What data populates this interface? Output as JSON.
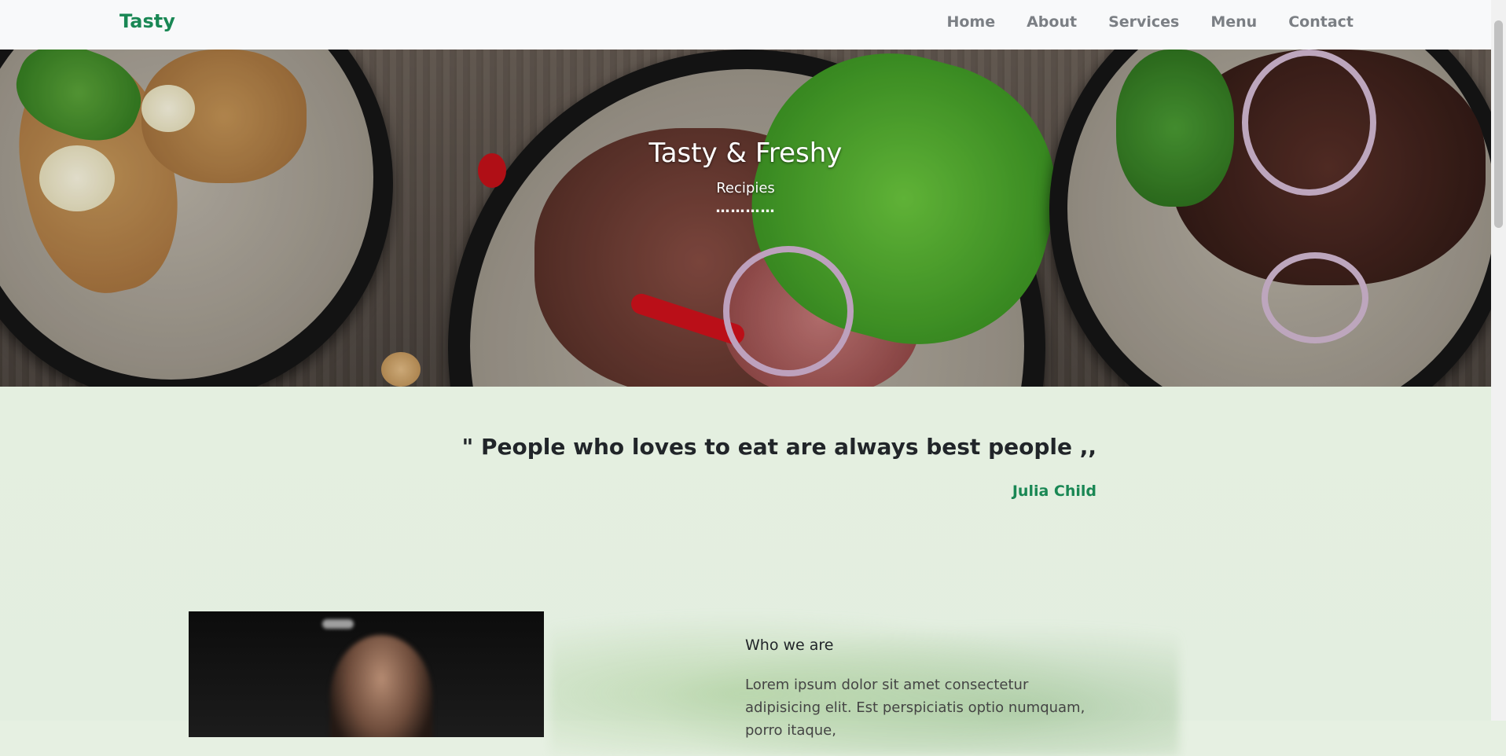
{
  "navbar": {
    "brand": "Tasty",
    "links": [
      "Home",
      "About",
      "Services",
      "Menu",
      "Contact"
    ]
  },
  "hero": {
    "title": "Tasty & Freshy",
    "subtitle": "Recipies",
    "divider": "…………"
  },
  "quote": {
    "text": "\" People who loves to eat are always best people ,,",
    "author": "Julia Child"
  },
  "about": {
    "heading": "Who we are",
    "body": "Lorem ipsum dolor sit amet consectetur adipisicing elit. Est perspiciatis optio numquam, porro itaque,"
  },
  "colors": {
    "brand": "#198754",
    "nav_link": "#7b7f84",
    "section_bg": "#e4efe0"
  }
}
